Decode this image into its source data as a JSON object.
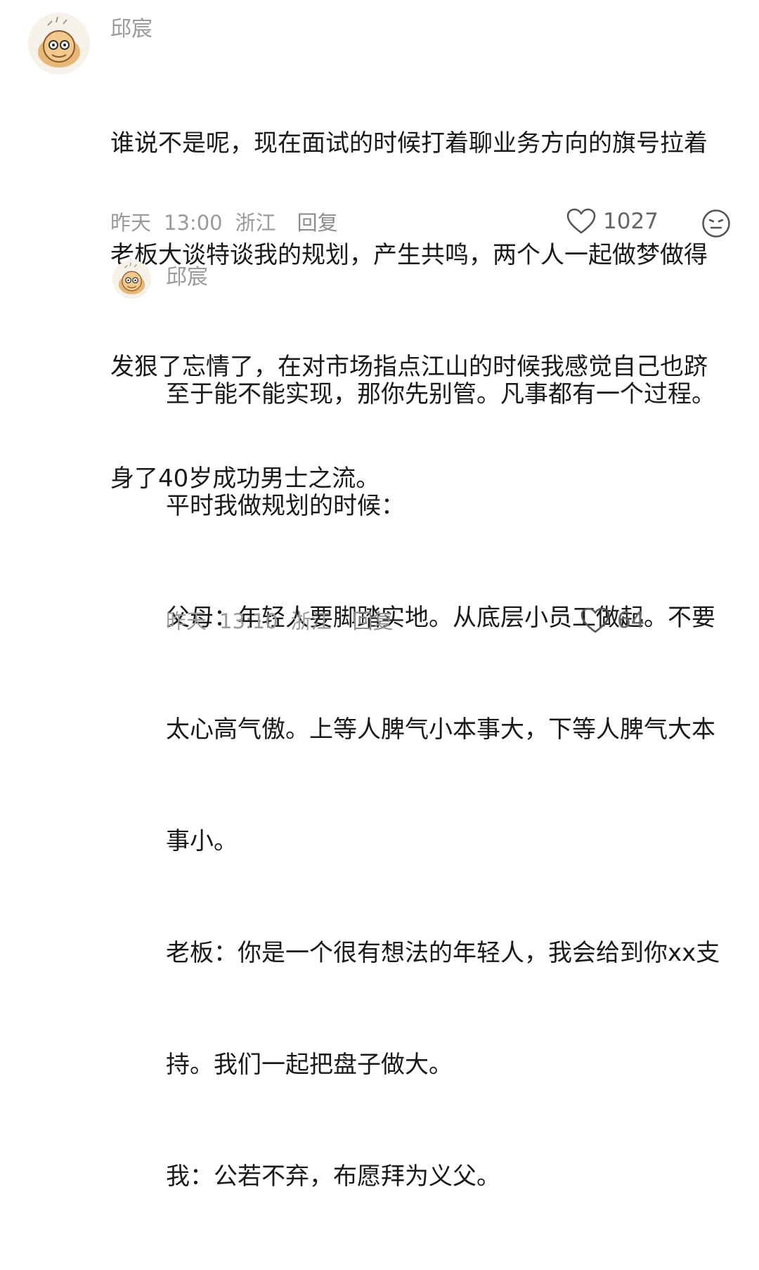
{
  "comments": [
    {
      "username": "邱宸",
      "lines": [
        "谁说不是呢，现在面试的时候打着聊业务方向的旗号拉着",
        "老板大谈特谈我的规划，产生共鸣，两个人一起做梦做得",
        "发狠了忘情了，在对市场指点江山的时候我感觉自己也跻",
        "身了40岁成功男士之流。"
      ],
      "date": "昨天",
      "time": "13:00",
      "location": "浙江",
      "reply_label": "回复",
      "likes": "1027",
      "avatar_icon": "cartoon-avatar-icon"
    },
    {
      "username": "邱宸",
      "lines": [
        "至于能不能实现，那你先别管。凡事都有一个过程。",
        "平时我做规划的时候：",
        "父母：年轻人要脚踏实地。从底层小员工做起。不要",
        "太心高气傲。上等人脾气小本事大，下等人脾气大本",
        "事小。",
        "老板：你是一个很有想法的年轻人，我会给到你xx支",
        "持。我们一起把盘子做大。",
        "我：公若不弃，布愿拜为义父。"
      ],
      "date": "昨天",
      "time": "13:10",
      "location": "浙江",
      "reply_label": "回复",
      "likes": "64",
      "avatar_icon": "cartoon-avatar-icon"
    }
  ],
  "colors": {
    "meta": "#9a9a9a",
    "text": "#1a1a1a",
    "icon": "#555555"
  }
}
